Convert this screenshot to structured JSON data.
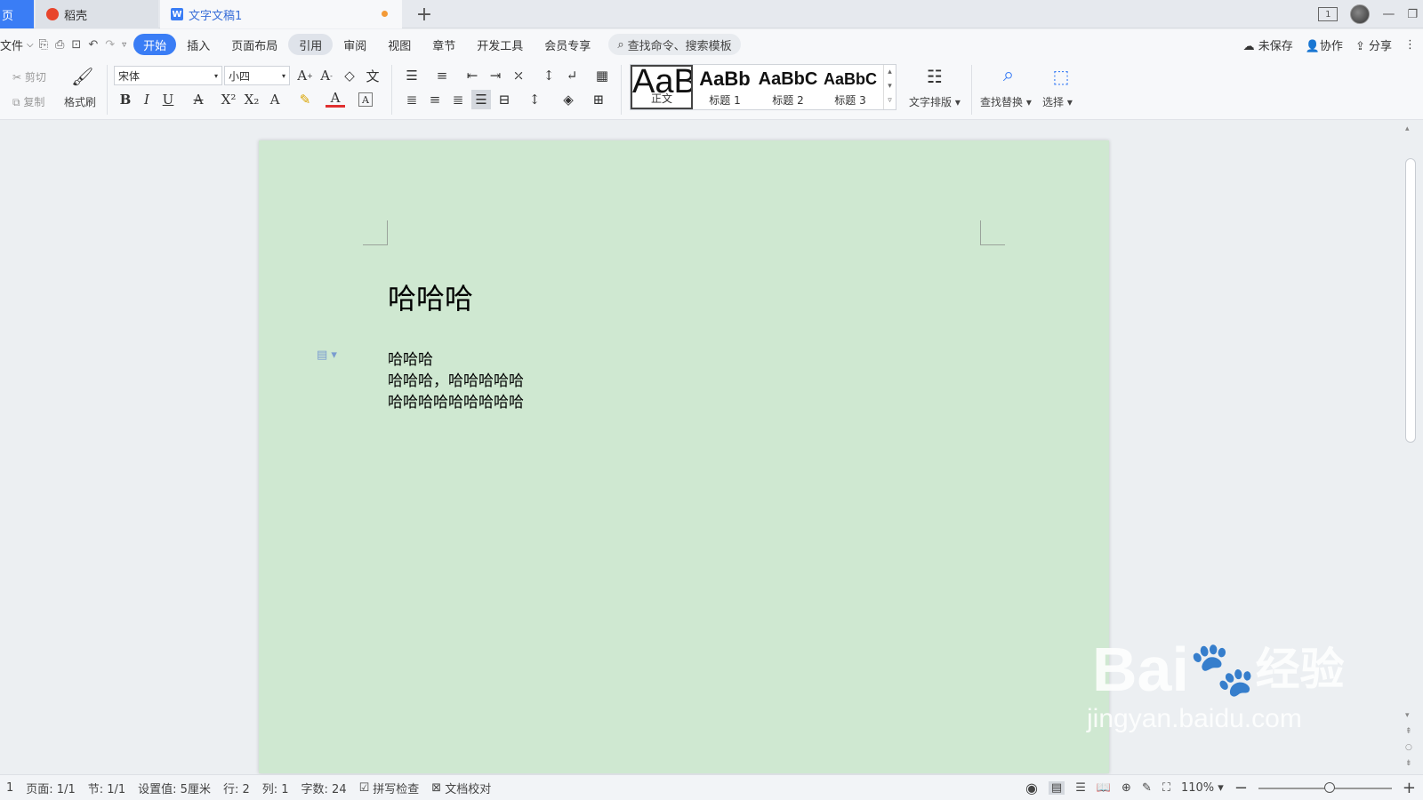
{
  "tabs": {
    "home": "页",
    "daoke": "稻壳",
    "doc": "文字文稿1"
  },
  "window": {
    "page_badge": "1"
  },
  "menu": {
    "file": "文件",
    "items": [
      "开始",
      "插入",
      "页面布局",
      "引用",
      "审阅",
      "视图",
      "章节",
      "开发工具",
      "会员专享"
    ],
    "search_placeholder": "查找命令、搜索模板",
    "unsaved": "未保存",
    "collab": "协作",
    "share": "分享"
  },
  "ribbon": {
    "cut": "剪切",
    "copy": "复制",
    "format_painter": "格式刷",
    "font": "宋体",
    "size": "小四",
    "styles": [
      {
        "preview": "AaBbCcDd",
        "label": "正文"
      },
      {
        "preview": "AaBb",
        "label": "标题 1"
      },
      {
        "preview": "AaBbC",
        "label": "标题 2"
      },
      {
        "preview": "AaBbC",
        "label": "标题 3"
      }
    ],
    "text_layout": "文字排版",
    "find_replace": "查找替换",
    "select": "选择"
  },
  "document": {
    "title": "哈哈哈",
    "lines": [
      "哈哈哈",
      "哈哈哈，哈哈哈哈哈",
      "哈哈哈哈哈哈哈哈哈"
    ]
  },
  "status": {
    "page_num": "1",
    "page": "页面: 1/1",
    "section": "节: 1/1",
    "setting": "设置值: 5厘米",
    "row": "行: 2",
    "col": "列: 1",
    "words": "字数: 24",
    "spell": "拼写检查",
    "proof": "文档校对",
    "zoom": "110%"
  },
  "watermark": {
    "line1": "Bai",
    "line2": "经验",
    "url": "jingyan.baidu.com"
  }
}
